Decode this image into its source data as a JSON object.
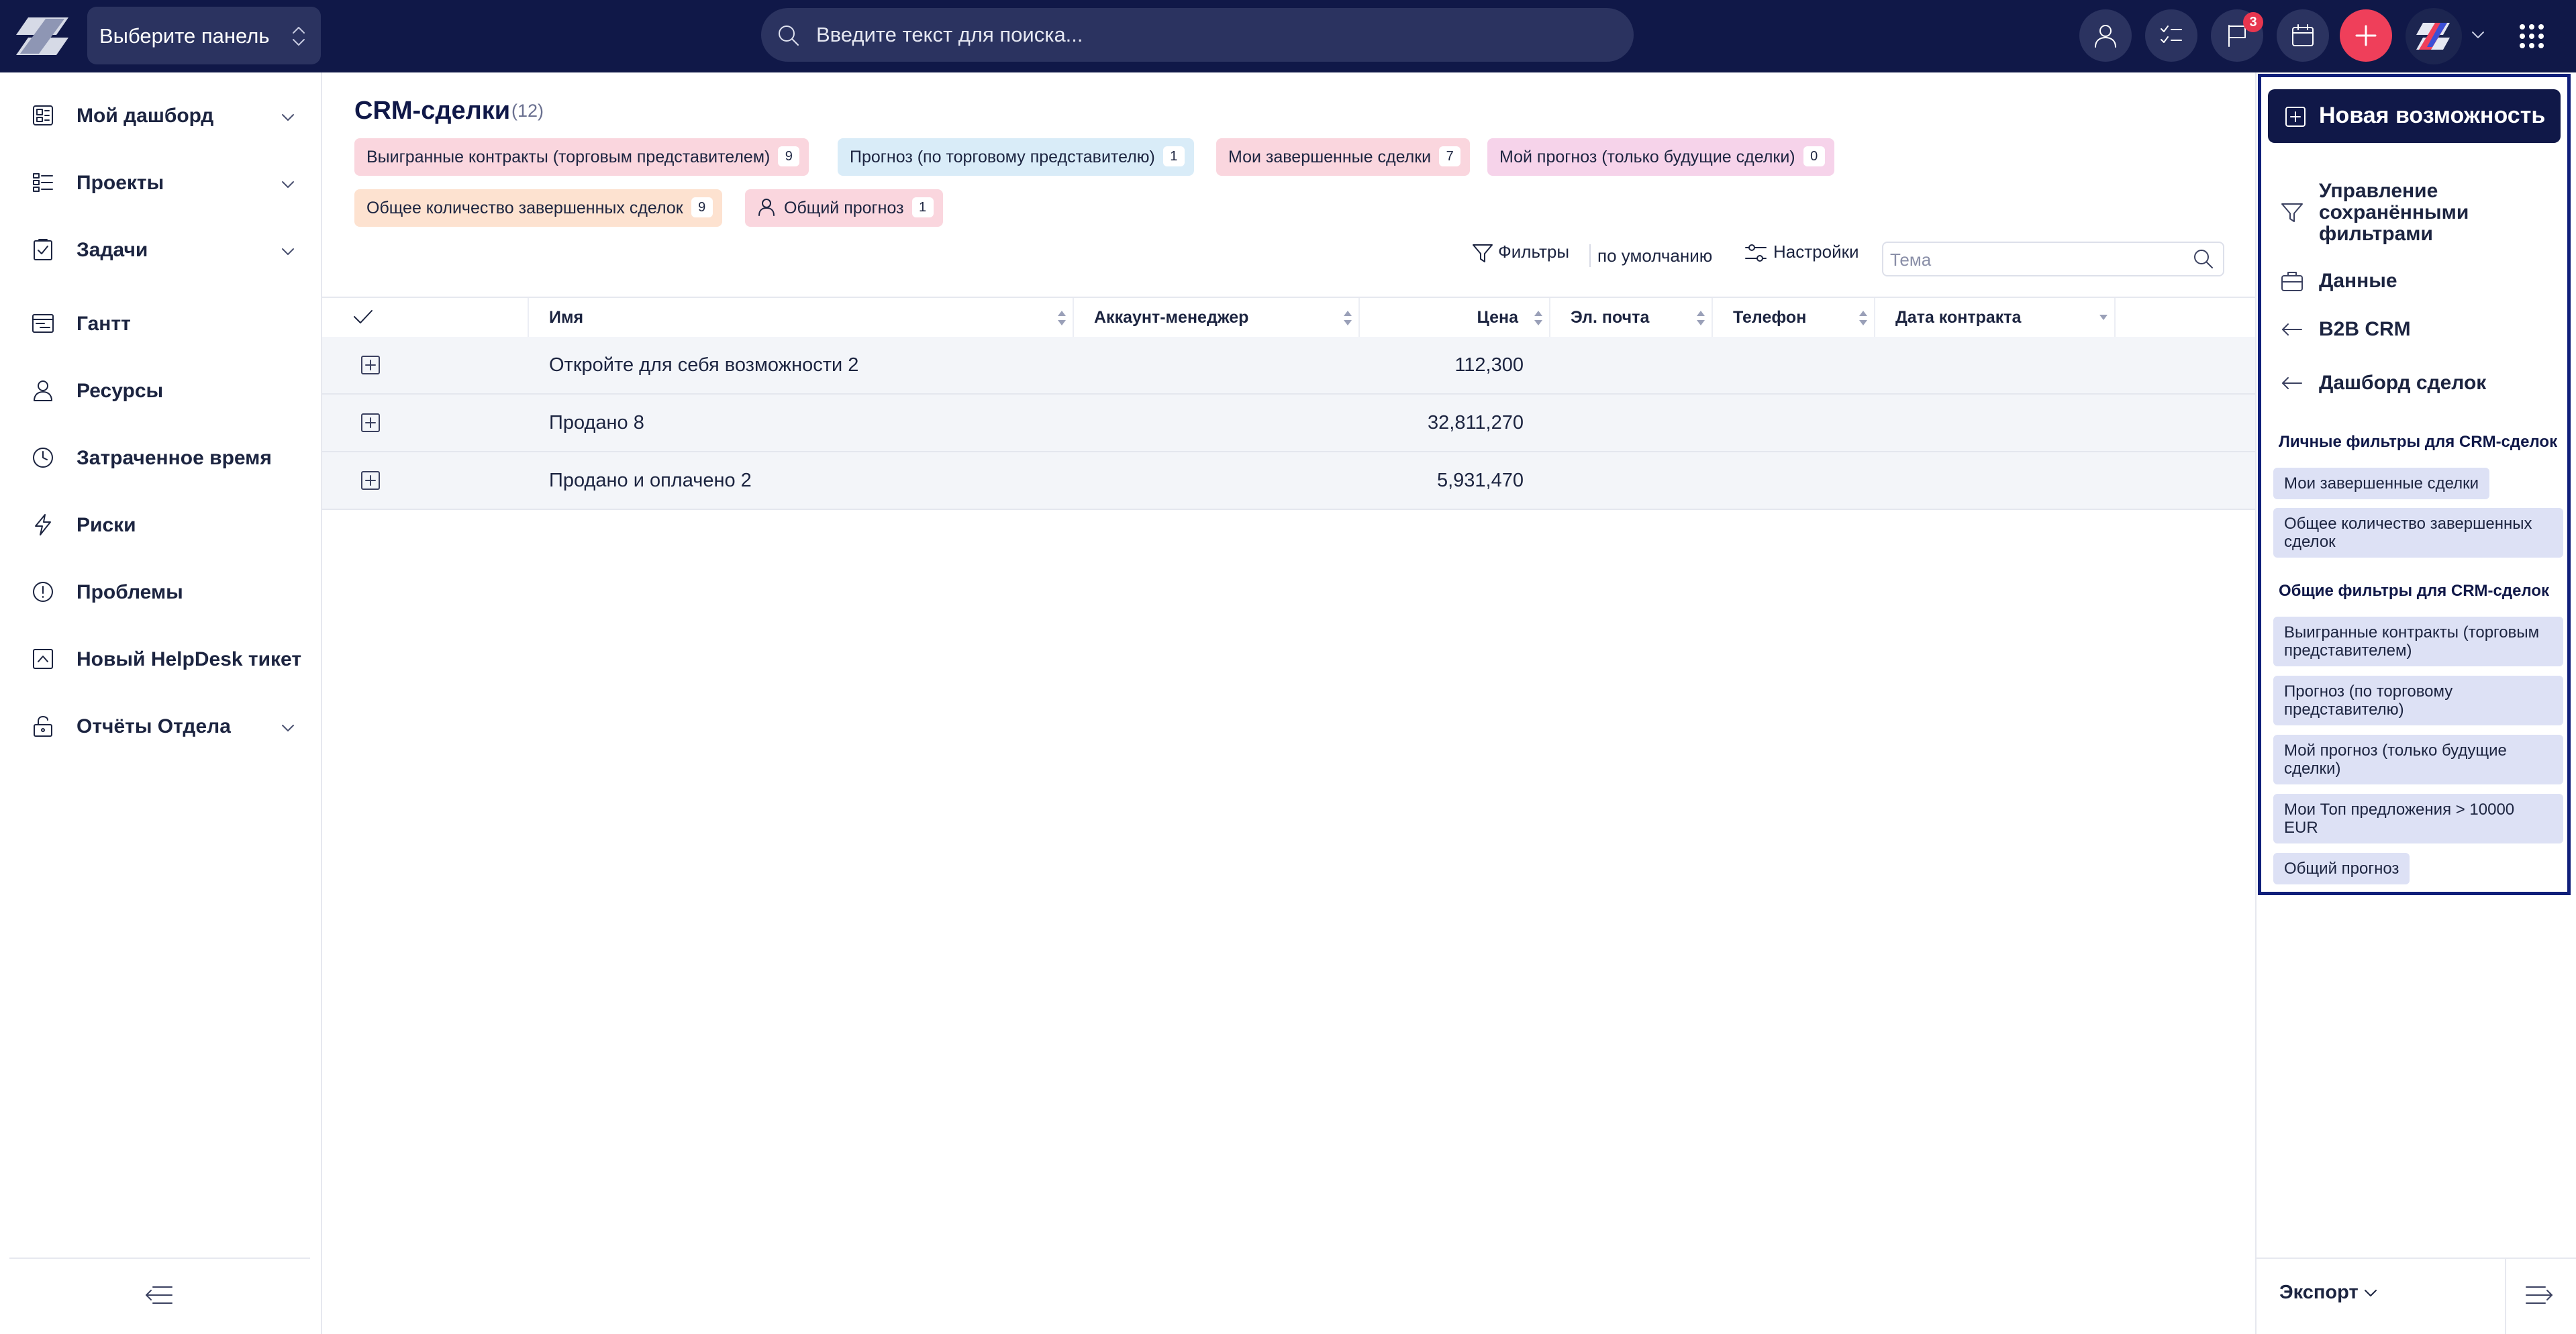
{
  "topbar": {
    "panel_select_label": "Выберите панель",
    "search_placeholder": "Введите текст для поиска...",
    "notifications_count": "3",
    "brand_color": "#101848",
    "add_button_color": "#ef3f5a"
  },
  "sidebar": {
    "items": [
      {
        "label": "Мой дашборд",
        "icon": "dashboard-icon",
        "expandable": true
      },
      {
        "label": "Проекты",
        "icon": "projects-icon",
        "expandable": true
      },
      {
        "label": "Задачи",
        "icon": "tasks-icon",
        "expandable": true
      },
      {
        "label": "Гантт",
        "icon": "gantt-icon",
        "expandable": false
      },
      {
        "label": "Ресурсы",
        "icon": "person-icon",
        "expandable": false
      },
      {
        "label": "Затраченное время",
        "icon": "clock-icon",
        "expandable": false
      },
      {
        "label": "Риски",
        "icon": "lightning-icon",
        "expandable": false
      },
      {
        "label": "Проблемы",
        "icon": "alert-icon",
        "expandable": false
      },
      {
        "label": "Новый HelpDesk тикет",
        "icon": "ticket-icon",
        "expandable": false
      },
      {
        "label": "Отчёты Отдела",
        "icon": "lock-icon",
        "expandable": true
      }
    ]
  },
  "main": {
    "title": "CRM-сделки",
    "count": "(12)",
    "chips": [
      {
        "label": "Выигранные контракты (торговым представителем)",
        "count": "9",
        "color": "#fad6de"
      },
      {
        "label": "Прогноз (по торговому представителю)",
        "count": "1",
        "color": "#d9ecf8"
      },
      {
        "label": "Мои завершенные сделки",
        "count": "7",
        "color": "#fad6de"
      },
      {
        "label": "Мой прогноз (только будущие сделки)",
        "count": "0",
        "color": "#f6d3ea"
      },
      {
        "label": "Общее количество завершенных сделок",
        "count": "9",
        "color": "#fde2d0"
      },
      {
        "label": "Общий прогноз",
        "count": "1",
        "color": "#fad6de"
      }
    ],
    "toolbar": {
      "filters_label": "Фильтры",
      "default_label": "по умолчанию",
      "settings_label": "Настройки",
      "topic_placeholder": "Тема"
    },
    "table": {
      "columns": [
        "Имя",
        "Аккаунт-менеджер",
        "Цена",
        "Эл. почта",
        "Телефон",
        "Дата контракта"
      ],
      "rows": [
        {
          "name": "Откройте для себя возможности",
          "count": "2",
          "price": "112,300"
        },
        {
          "name": "Продано",
          "count": "8",
          "price": "32,811,270"
        },
        {
          "name": "Продано и оплачено",
          "count": "2",
          "price": "5,931,470"
        }
      ]
    }
  },
  "right_panel": {
    "new_opportunity": "Новая возможность",
    "links": [
      {
        "label": "Управление сохранёнными фильтрами",
        "icon": "filter-icon"
      },
      {
        "label": "Данные",
        "icon": "briefcase-icon"
      },
      {
        "label": "B2B CRM",
        "icon": "arrow-left-icon"
      },
      {
        "label": "Дашборд сделок",
        "icon": "arrow-left-icon"
      }
    ],
    "personal_title": "Личные фильтры для CRM-сделок",
    "personal_filters": [
      "Мои завершенные сделки",
      "Общее количество завершенных сделок"
    ],
    "shared_title": "Общие фильтры для CRM-сделок",
    "shared_filters": [
      "Выигранные контракты (торговым представителем)",
      "Прогноз (по торговому представителю)",
      "Мой прогноз (только будущие сделки)",
      "Мои Топ предложения > 10000 EUR",
      "Общий прогноз"
    ],
    "export_label": "Экспорт"
  }
}
